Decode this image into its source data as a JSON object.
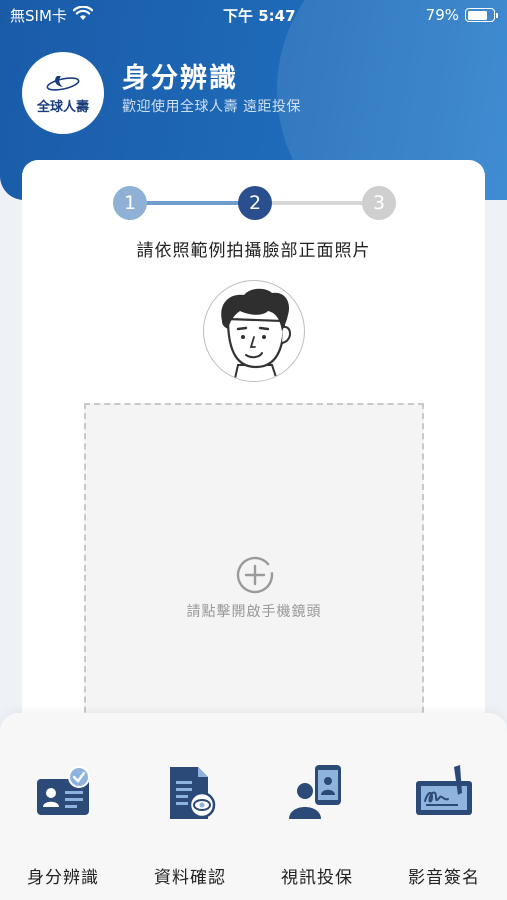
{
  "status_bar": {
    "carrier": "無SIM卡",
    "time": "下午 5:47",
    "battery": "79%",
    "battery_level": 0.79
  },
  "header": {
    "logo_text": "全球人壽",
    "title": "身分辨識",
    "subtitle": "歡迎使用全球人壽  遠距投保"
  },
  "stepper": {
    "steps": [
      "1",
      "2",
      "3"
    ],
    "current": 2,
    "colors": {
      "done": "#8fb1d6",
      "active": "#2a4f8f",
      "pending": "#cfcfcf",
      "line_done": "#6f9ccb"
    }
  },
  "instruction": "請依照範例拍攝臉部正面照片",
  "upload": {
    "label": "請點擊開啟手機鏡頭"
  },
  "bottom_nav": {
    "items": [
      {
        "label": "身分辨識",
        "icon": "id-card-check-icon"
      },
      {
        "label": "資料確認",
        "icon": "document-eye-icon"
      },
      {
        "label": "視訊投保",
        "icon": "video-call-icon"
      },
      {
        "label": "影音簽名",
        "icon": "tablet-signature-icon"
      }
    ]
  },
  "colors": {
    "brand_blue": "#1a5ba8",
    "icon_navy": "#2c4a78",
    "icon_light": "#8eb4de"
  }
}
